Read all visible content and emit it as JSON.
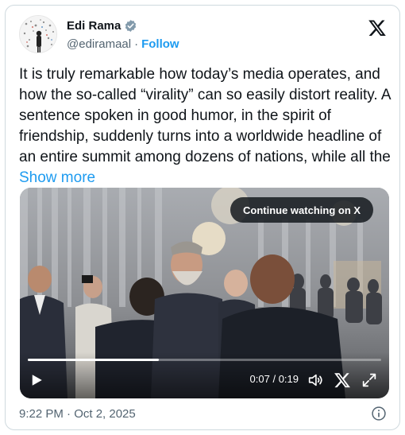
{
  "author": {
    "name": "Edi Rama",
    "handle": "@ediramaal",
    "separator": "·",
    "follow_label": "Follow",
    "verified": true
  },
  "tweet": {
    "text": "It is truly remarkable how today’s media operates, and how the so-called “virality” can so easily distort reality. A sentence spoken in good humor, in the spirit of friendship, suddenly turns into a worldwide headline of an entire summit among dozens of nations, while all the ",
    "show_more_label": "Show more"
  },
  "video": {
    "continue_label": "Continue watching on X",
    "current_time": "0:07",
    "separator": "/",
    "duration": "0:19",
    "progress_fraction": 0.37
  },
  "footer": {
    "timestamp": "9:22 PM · Oct 2, 2025"
  },
  "colors": {
    "accent": "#1d9bf0",
    "text": "#0f1419",
    "muted": "#536471"
  },
  "icons": [
    "verified-badge-icon",
    "x-logo-icon",
    "play-icon",
    "volume-icon",
    "x-small-icon",
    "expand-icon",
    "info-icon"
  ]
}
